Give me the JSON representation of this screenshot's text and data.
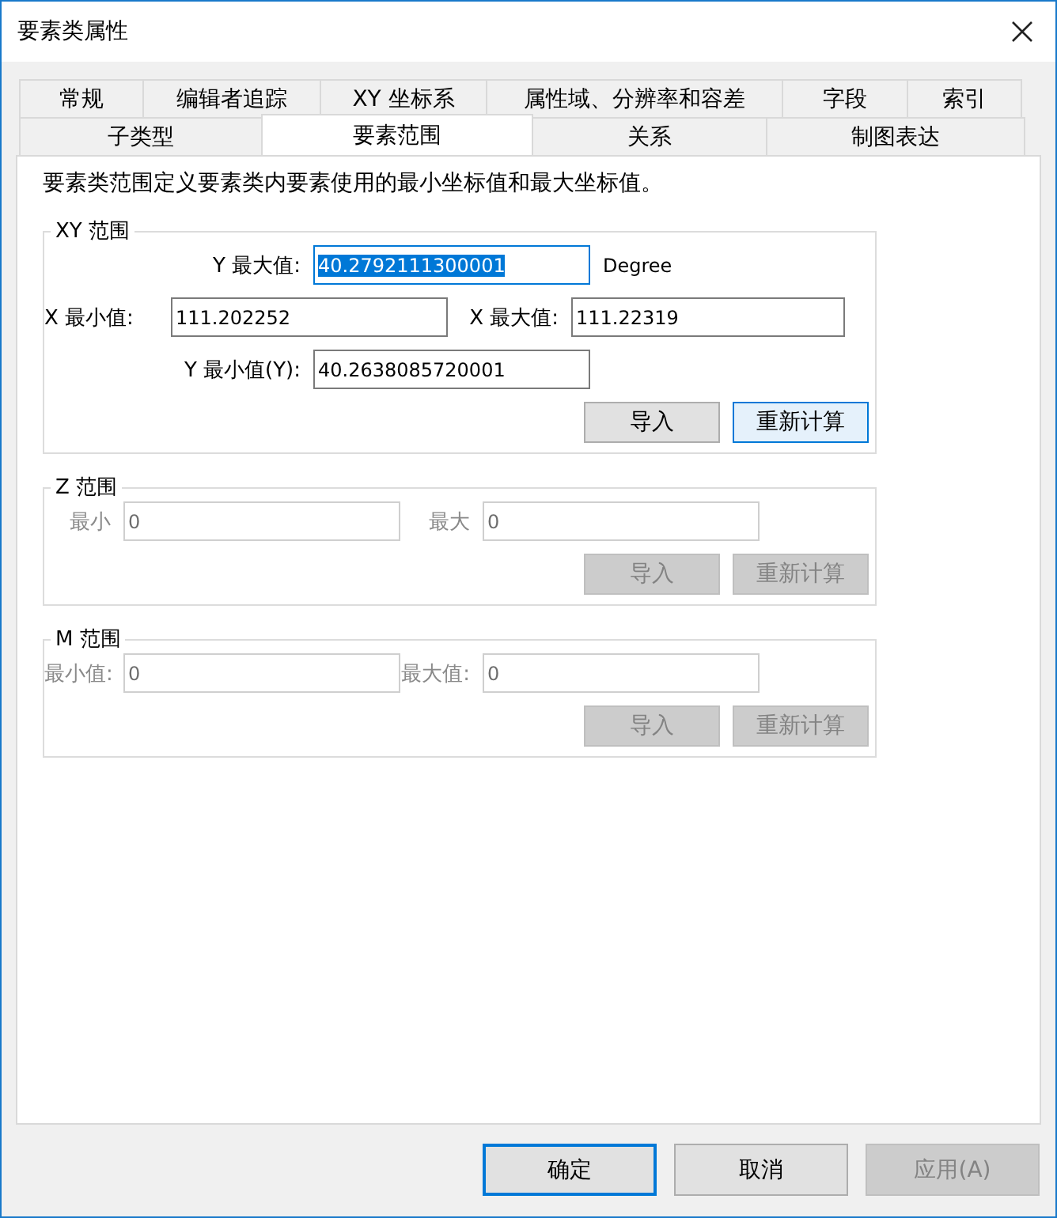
{
  "window": {
    "title": "要素类属性"
  },
  "tab_rows": [
    [
      {
        "label": "常规",
        "selected": false
      },
      {
        "label": "编辑者追踪",
        "selected": false
      },
      {
        "label": "XY 坐标系",
        "selected": false
      },
      {
        "label": "属性域、分辨率和容差",
        "selected": false
      },
      {
        "label": "字段",
        "selected": false
      },
      {
        "label": "索引",
        "selected": false
      }
    ],
    [
      {
        "label": "子类型",
        "selected": false
      },
      {
        "label": "要素范围",
        "selected": true
      },
      {
        "label": "关系",
        "selected": false
      },
      {
        "label": "制图表达",
        "selected": false
      }
    ]
  ],
  "description": "要素类范围定义要素类内要素使用的最小坐标值和最大坐标值。",
  "groups": [
    {
      "kind": "xy",
      "title": "XY 范围",
      "disabled": false,
      "unit": "Degree",
      "fields": [
        {
          "label": "Y 最大值:",
          "value": "40.2792111300001",
          "selected": true
        },
        {
          "label": "X 最小值:",
          "value": "111.202252",
          "selected": false
        },
        {
          "label": "X 最大值:",
          "value": "111.22319",
          "selected": false
        },
        {
          "label": "Y 最小值(Y):",
          "value": "40.2638085720001",
          "selected": false
        }
      ],
      "buttons": [
        {
          "label": "导入",
          "focused": false
        },
        {
          "label": "重新计算",
          "focused": true
        }
      ]
    },
    {
      "kind": "pair",
      "title": "Z 范围",
      "disabled": true,
      "fields": [
        {
          "label": "最小",
          "value": "0",
          "selected": false
        },
        {
          "label": "最大",
          "value": "0",
          "selected": false
        }
      ],
      "buttons": [
        {
          "label": "导入",
          "focused": false
        },
        {
          "label": "重新计算",
          "focused": false
        }
      ]
    },
    {
      "kind": "pair",
      "title": "M 范围",
      "disabled": true,
      "fields": [
        {
          "label": "最小值:",
          "value": "0",
          "selected": false
        },
        {
          "label": "最大值:",
          "value": "0",
          "selected": false
        }
      ],
      "buttons": [
        {
          "label": "导入",
          "focused": false
        },
        {
          "label": "重新计算",
          "focused": false
        }
      ]
    }
  ],
  "footer_buttons": [
    {
      "label": "确定",
      "default": true,
      "disabled": false
    },
    {
      "label": "取消",
      "default": false,
      "disabled": false
    },
    {
      "label": "应用(A)",
      "default": false,
      "disabled": true
    }
  ]
}
